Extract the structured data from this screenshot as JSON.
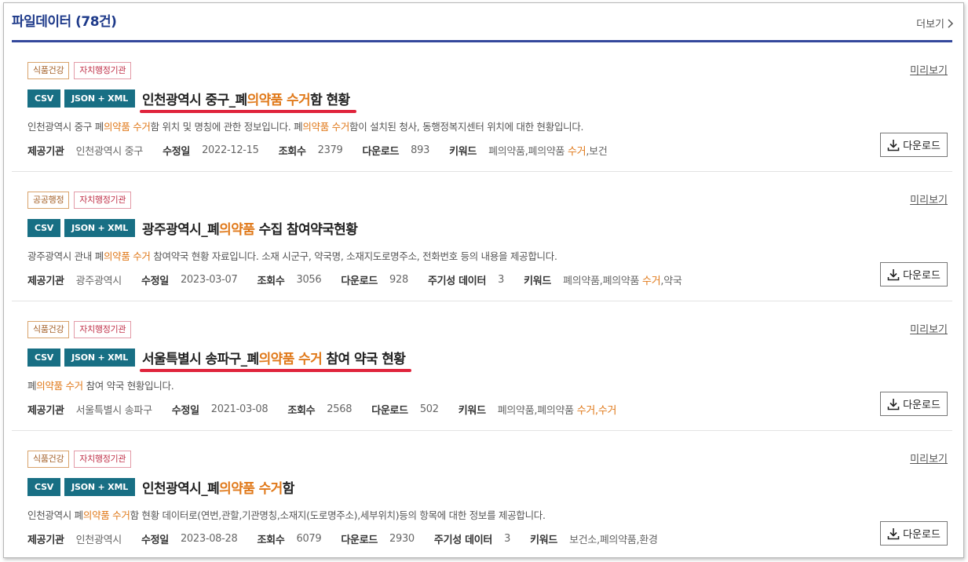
{
  "header": {
    "title": "파일데이터 (78건)",
    "more_label": "더보기"
  },
  "labels": {
    "preview": "미리보기",
    "download": "다운로드",
    "provider": "제공기관",
    "modified": "수정일",
    "views": "조회수",
    "downloads": "다운로드",
    "periodic": "주기성 데이터",
    "keywords": "키워드"
  },
  "items": [
    {
      "categories": [
        {
          "text": "식품건강",
          "kind": "food"
        },
        {
          "text": "자치행정기관",
          "kind": "local"
        }
      ],
      "formats": [
        "CSV",
        "JSON + XML"
      ],
      "title": [
        "인천광역시 중구_폐",
        "의약품 수거",
        "함 현황"
      ],
      "desc": [
        "인천광역시 중구 폐",
        "의약품 수거",
        "함 위치 및 명칭에 관한 정보입니다. 폐",
        "의약품 수거",
        "함이 설치된 청사, 동행정복지센터 위치에 대한 현황입니다."
      ],
      "provider": "인천광역시 중구",
      "modified": "2022-12-15",
      "views": "2379",
      "downloads": "893",
      "periodic": null,
      "keywords": [
        "폐의약품,폐의약품 ",
        "수거",
        ",보건"
      ],
      "underlined": true
    },
    {
      "categories": [
        {
          "text": "공공행정",
          "kind": "public"
        },
        {
          "text": "자치행정기관",
          "kind": "local"
        }
      ],
      "formats": [
        "CSV",
        "JSON + XML"
      ],
      "title": [
        "광주광역시_폐",
        "의약품",
        " 수집 참여약국현황"
      ],
      "desc": [
        "광주광역시 관내 폐",
        "의약품 수거",
        " 참여약국 현황 자료입니다. 소재 시군구, 약국명, 소재지도로명주소, 전화번호 등의 내용을 제공합니다."
      ],
      "provider": "광주광역시",
      "modified": "2023-03-07",
      "views": "3056",
      "downloads": "928",
      "periodic": "3",
      "keywords": [
        "폐의약품,폐의약품 ",
        "수거",
        ",약국"
      ],
      "underlined": false
    },
    {
      "categories": [
        {
          "text": "식품건강",
          "kind": "food"
        },
        {
          "text": "자치행정기관",
          "kind": "local"
        }
      ],
      "formats": [
        "CSV",
        "JSON + XML"
      ],
      "title": [
        "서울특별시 송파구_폐",
        "의약품 수거",
        " 참여 약국 현황"
      ],
      "desc": [
        "폐",
        "의약품 수거",
        " 참여 약국 현황입니다."
      ],
      "provider": "서울특별시 송파구",
      "modified": "2021-03-08",
      "views": "2568",
      "downloads": "502",
      "periodic": null,
      "keywords": [
        "폐의약품,폐의약품 ",
        "수거,수거",
        ""
      ],
      "underlined": true
    },
    {
      "categories": [
        {
          "text": "식품건강",
          "kind": "food"
        },
        {
          "text": "자치행정기관",
          "kind": "local"
        }
      ],
      "formats": [
        "CSV",
        "JSON + XML"
      ],
      "title": [
        "인천광역시_폐",
        "의약품 수거",
        "함"
      ],
      "desc": [
        "인천광역시 폐",
        "의약품 수거",
        "함 현황 데이터로(연번,관할,기관명칭,소재지(도로명주소),세부위치)등의 항목에 대한 정보를 제공합니다."
      ],
      "provider": "인천광역시",
      "modified": "2023-08-28",
      "views": "6079",
      "downloads": "2930",
      "periodic": "3",
      "keywords": [
        "보건소,폐의약품,환경",
        "",
        ""
      ],
      "underlined": false
    }
  ]
}
